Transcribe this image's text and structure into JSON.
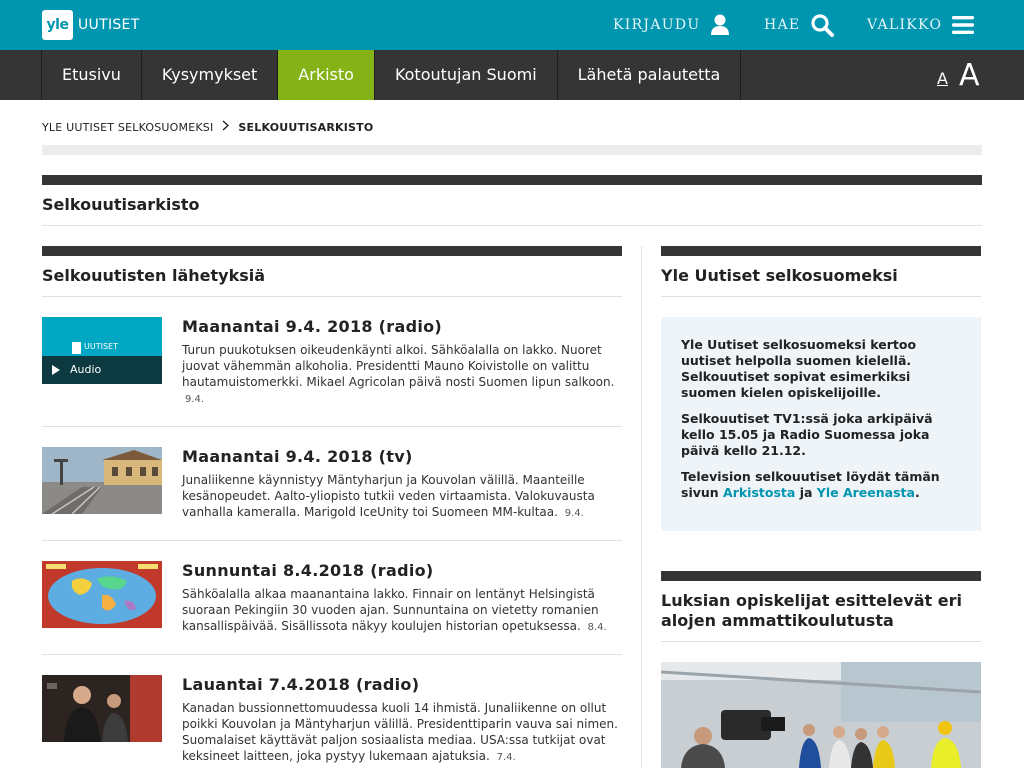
{
  "header": {
    "logo_mark": "yle",
    "logo_text": "UUTISET",
    "login_label": "KIRJAUDU",
    "search_label": "HAE",
    "menu_label": "VALIKKO",
    "brand_color": "#0096b0"
  },
  "nav": {
    "items": [
      {
        "label": "Etusivu"
      },
      {
        "label": "Kysymykset"
      },
      {
        "label": "Arkisto"
      },
      {
        "label": "Kotoutujan Suomi"
      },
      {
        "label": "Lähetä palautetta"
      }
    ],
    "active_index": 2,
    "active_color": "#84b217",
    "font_small": "A",
    "font_large": "A"
  },
  "breadcrumb": {
    "parent": "YLE UUTISET SELKOSUOMEKSI",
    "current": "SELKOUUTISARKISTO"
  },
  "page": {
    "title": "Selkouutisarkisto"
  },
  "left": {
    "title": "Selkouutisten lähetyksiä",
    "items": [
      {
        "title": "Maanantai 9.4. 2018 (radio)",
        "desc": "Turun puukotuksen oikeudenkäynti alkoi. Sähköalalla on lakko. Nuoret juovat vähemmän alkoholia. Presidentti Mauno Koivistolle on valittu hautamuistomerkki. Mikael Agricolan päivä nosti Suomen lipun salkoon.",
        "date": "9.4.",
        "thumb_badge": "Audio",
        "thumb_logo": "UUTISET"
      },
      {
        "title": "Maanantai 9.4. 2018 (tv)",
        "desc": "Junaliikenne käynnistyy Mäntyharjun ja Kouvolan välillä. Maanteille kesänopeudet. Aalto-yliopisto tutkii veden virtaamista. Valokuvausta vanhalla kameralla. Marigold IceUnity toi Suomeen MM-kultaa.",
        "date": "9.4."
      },
      {
        "title": "Sunnuntai 8.4.2018 (radio)",
        "desc": "Sähköalalla alkaa maanantaina lakko. Finnair on lentänyt Helsingistä suoraan Pekingiin 30 vuoden ajan. Sunnuntaina on vietetty romanien kansallispäivää. Sisällissota näkyy koulujen historian opetuksessa.",
        "date": "8.4."
      },
      {
        "title": "Lauantai 7.4.2018 (radio)",
        "desc": "Kanadan bussionnettomuudessa kuoli 14 ihmistä. Junaliikenne on ollut poikki Kouvolan ja Mäntyharjun välillä. Presidenttiparin vauva sai nimen. Suomalaiset käyttävät paljon sosiaalista mediaa. USA:ssa tutkijat ovat keksineet laitteen, joka pystyy lukemaan ajatuksia.",
        "date": "7.4."
      }
    ]
  },
  "right": {
    "title": "Yle Uutiset selkosuomeksi",
    "info": {
      "p1": "Yle Uutiset selkosuomeksi kertoo uutiset helpolla suomen kielellä. Selkouutiset sopivat esimerkiksi suomen kielen opiskelijoille.",
      "p2": "Selkouutiset TV1:ssä joka arkipäivä kello 15.05 ja Radio Suomessa joka päivä kello 21.12.",
      "p3_pre": "Television selkouutiset löydät tämän sivun",
      "link1": "Arkistosta",
      "p3_mid": "ja",
      "link2": "Yle Areenasta",
      "p3_end": "."
    },
    "promo_title": "Luksian opiskelijat esittelevät eri alojen ammattikoulutusta"
  }
}
